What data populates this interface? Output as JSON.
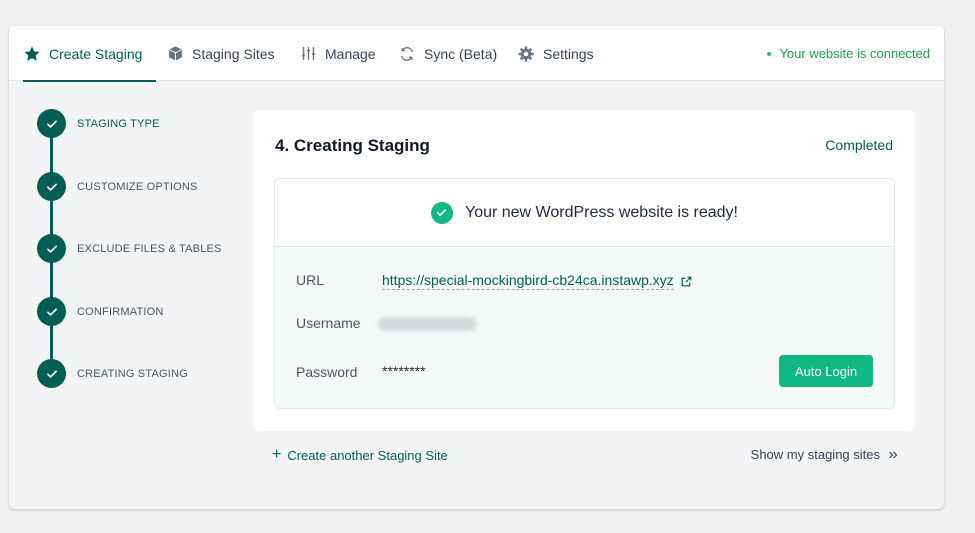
{
  "tabs": [
    {
      "label": "Create Staging",
      "icon": "star-icon"
    },
    {
      "label": "Staging Sites",
      "icon": "box-icon"
    },
    {
      "label": "Manage",
      "icon": "sliders-icon"
    },
    {
      "label": "Sync (Beta)",
      "icon": "sync-icon"
    },
    {
      "label": "Settings",
      "icon": "gear-icon"
    }
  ],
  "connection_status": "Your website is connected",
  "steps": [
    {
      "label": "STAGING TYPE"
    },
    {
      "label": "CUSTOMIZE OPTIONS"
    },
    {
      "label": "EXCLUDE FILES & TABLES"
    },
    {
      "label": "CONFIRMATION"
    },
    {
      "label": "CREATING STAGING"
    }
  ],
  "card": {
    "title": "4. Creating Staging",
    "status": "Completed",
    "ready_message": "Your new WordPress website is ready!",
    "url_label": "URL",
    "url_value": "https://special-mockingbird-cb24ca.instawp.xyz",
    "username_label": "Username",
    "password_label": "Password",
    "password_value": "********",
    "auto_login_label": "Auto Login"
  },
  "footer": {
    "create_another": "Create another Staging Site",
    "show_sites": "Show my staging sites"
  },
  "colors": {
    "brand": "#005e54",
    "accent": "#10b981",
    "connected": "#16a34a"
  }
}
